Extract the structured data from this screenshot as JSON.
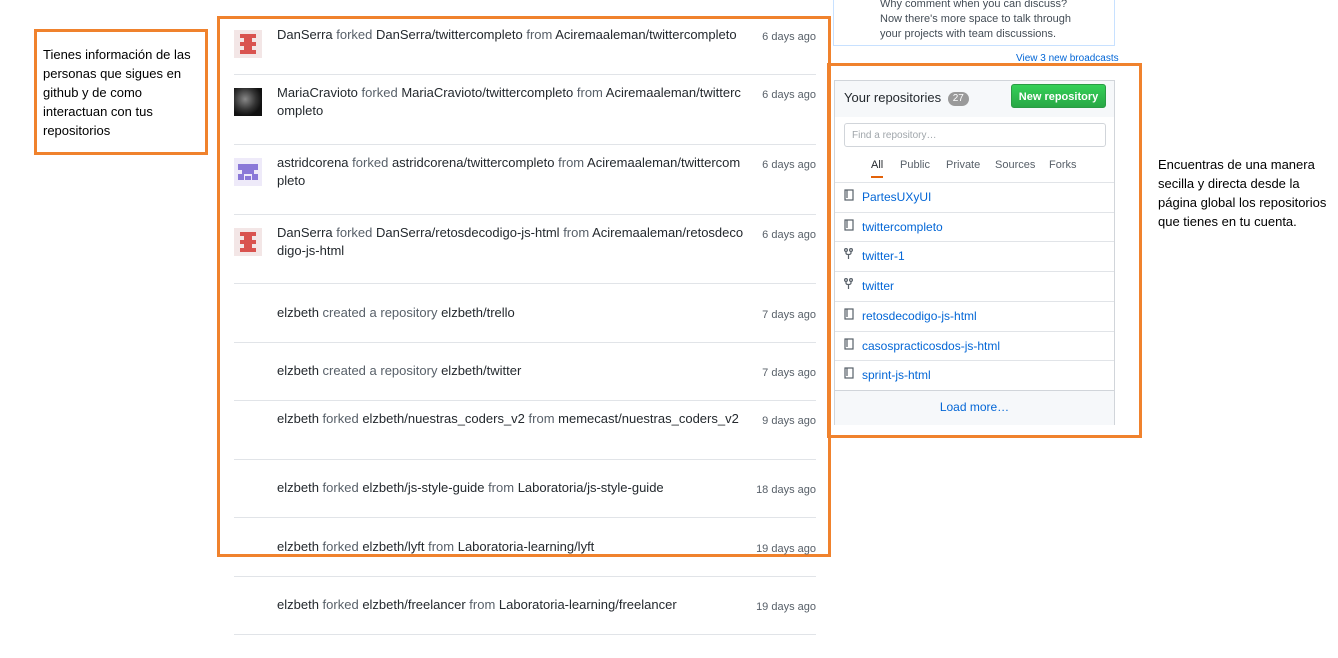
{
  "annotations": {
    "left_note": "Tienes información de las personas que sigues en github y de como interactuan con tus repositorios",
    "right_note": "Encuentras de una manera secilla y directa desde la página global los repositorios que tienes en tu cuenta."
  },
  "broadcast": {
    "text": "Why comment when you can discuss? Now there's more space to talk through your projects with team discussions.",
    "view_link": "View 3 new broadcasts"
  },
  "feed": [
    {
      "actor": "DanSerra",
      "verb": "forked",
      "target": "DanSerra/twittercompleto",
      "prep": "from",
      "source": "Aciremaaleman/twittercompleto",
      "time": "6 days ago",
      "avatar": "identicon-red"
    },
    {
      "actor": "MariaCravioto",
      "verb": "forked",
      "target": "MariaCravioto/twittercompleto",
      "prep": "from",
      "source": "Aciremaaleman/twittercompleto",
      "time": "6 days ago",
      "avatar": "photo"
    },
    {
      "actor": "astridcorena",
      "verb": "forked",
      "target": "astridcorena/twittercompleto",
      "prep": "from",
      "source": "Aciremaaleman/twittercompleto",
      "time": "6 days ago",
      "avatar": "identicon-purple"
    },
    {
      "actor": "DanSerra",
      "verb": "forked",
      "target": "DanSerra/retosdecodigo-js-html",
      "prep": "from",
      "source": "Aciremaaleman/retosdecodigo-js-html",
      "time": "6 days ago",
      "avatar": "identicon-red"
    },
    {
      "actor": "elzbeth",
      "verb": "created a repository",
      "target": "elzbeth/trello",
      "prep": "",
      "source": "",
      "time": "7 days ago",
      "avatar": ""
    },
    {
      "actor": "elzbeth",
      "verb": "created a repository",
      "target": "elzbeth/twitter",
      "prep": "",
      "source": "",
      "time": "7 days ago",
      "avatar": ""
    },
    {
      "actor": "elzbeth",
      "verb": "forked",
      "target": "elzbeth/nuestras_coders_v2",
      "prep": "from",
      "source": "memecast/nuestras_coders_v2",
      "time": "9 days ago",
      "avatar": ""
    },
    {
      "actor": "elzbeth",
      "verb": "forked",
      "target": "elzbeth/js-style-guide",
      "prep": "from",
      "source": "Laboratoria/js-style-guide",
      "time": "18 days ago",
      "avatar": ""
    },
    {
      "actor": "elzbeth",
      "verb": "forked",
      "target": "elzbeth/lyft",
      "prep": "from",
      "source": "Laboratoria-learning/lyft",
      "time": "19 days ago",
      "avatar": ""
    },
    {
      "actor": "elzbeth",
      "verb": "forked",
      "target": "elzbeth/freelancer",
      "prep": "from",
      "source": "Laboratoria-learning/freelancer",
      "time": "19 days ago",
      "avatar": ""
    }
  ],
  "repos": {
    "title": "Your repositories",
    "count": "27",
    "new_button": "New repository",
    "search_placeholder": "Find a repository…",
    "filters": [
      "All",
      "Public",
      "Private",
      "Sources",
      "Forks"
    ],
    "items": [
      {
        "name": "PartesUXyUI",
        "icon": "repo-icon"
      },
      {
        "name": "twittercompleto",
        "icon": "repo-icon"
      },
      {
        "name": "twitter-1",
        "icon": "fork-icon"
      },
      {
        "name": "twitter",
        "icon": "fork-icon"
      },
      {
        "name": "retosdecodigo-js-html",
        "icon": "repo-icon"
      },
      {
        "name": "casospracticosdos-js-html",
        "icon": "repo-icon"
      },
      {
        "name": "sprint-js-html",
        "icon": "repo-icon"
      }
    ],
    "load_more": "Load more…"
  }
}
